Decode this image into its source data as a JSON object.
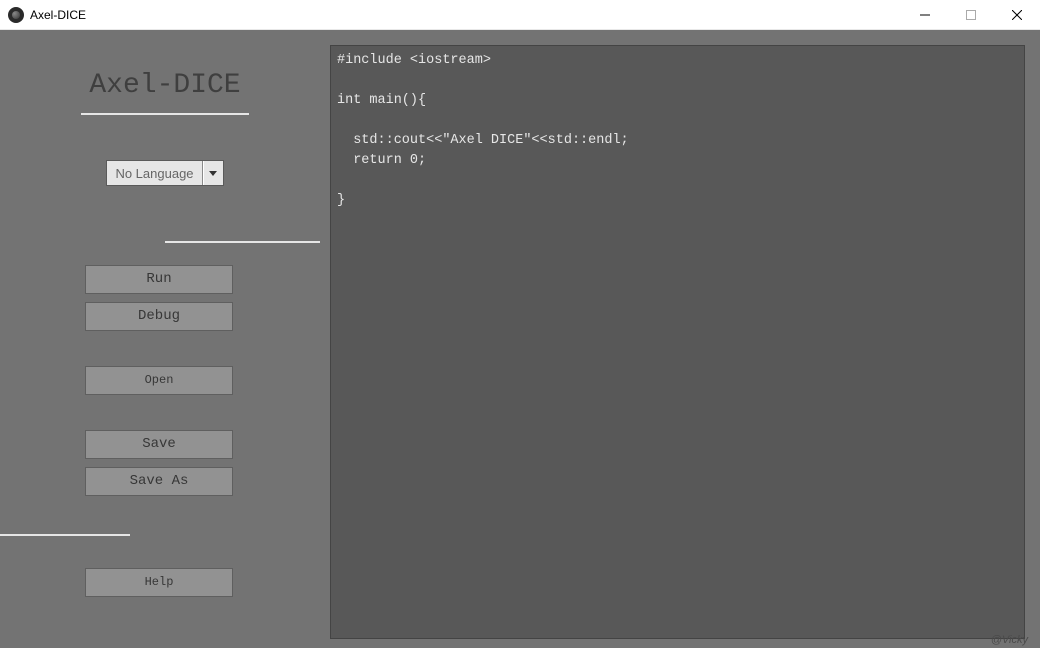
{
  "window": {
    "title": "Axel-DICE"
  },
  "sidebar": {
    "app_title": "Axel-DICE",
    "language_select": {
      "selected": "No Language"
    },
    "buttons": {
      "run": "Run",
      "debug": "Debug",
      "open": "Open",
      "save": "Save",
      "save_as": "Save As",
      "help": "Help"
    }
  },
  "editor": {
    "content": "#include <iostream>\n\nint main(){\n\n  std::cout<<\"Axel DICE\"<<std::endl;\n  return 0;\n\n}"
  },
  "watermark": "@Vicky"
}
